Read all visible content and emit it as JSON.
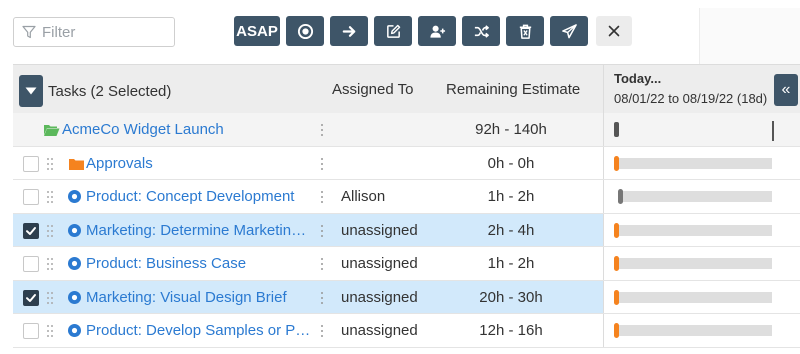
{
  "toolbar": {
    "filter_placeholder": "Filter",
    "asap_label": "ASAP",
    "buttons": [
      {
        "name": "asap-button",
        "icon": "text"
      },
      {
        "name": "target-button",
        "icon": "target-icon"
      },
      {
        "name": "move-right-button",
        "icon": "arrow-right-icon"
      },
      {
        "name": "edit-button",
        "icon": "edit-icon"
      },
      {
        "name": "assign-user-button",
        "icon": "add-user-icon"
      },
      {
        "name": "shuffle-button",
        "icon": "shuffle-icon"
      },
      {
        "name": "delete-button",
        "icon": "trash-icon"
      },
      {
        "name": "send-button",
        "icon": "send-icon"
      },
      {
        "name": "close-button",
        "icon": "close-icon"
      }
    ]
  },
  "header": {
    "title": "Tasks (2 Selected)",
    "assigned_col": "Assigned To",
    "remaining_col": "Remaining Estimate",
    "timeline_today": "Today...",
    "timeline_range": "08/01/22 to 08/19/22 (18d)"
  },
  "rows": [
    {
      "type": "group",
      "name": "AcmeCo Widget Launch",
      "assigned": "",
      "estimate": "92h - 140h",
      "selected": false,
      "icon": "folder-open-icon",
      "icon_color": "#5cb85c"
    },
    {
      "type": "folder",
      "name": "Approvals",
      "assigned": "",
      "estimate": "0h - 0h",
      "selected": false,
      "icon": "folder-icon",
      "icon_color": "#f5831f",
      "bar": "orange"
    },
    {
      "type": "task",
      "name": "Product: Concept Development",
      "assigned": "Allison",
      "estimate": "1h - 2h",
      "selected": false,
      "icon": "task-circle-icon",
      "bar": "grey"
    },
    {
      "type": "task",
      "name": "Marketing: Determine Marketing ...",
      "assigned": "unassigned",
      "estimate": "2h - 4h",
      "selected": true,
      "icon": "task-circle-icon",
      "bar": "orange"
    },
    {
      "type": "task",
      "name": "Product: Business Case",
      "assigned": "unassigned",
      "estimate": "1h - 2h",
      "selected": false,
      "icon": "task-circle-icon",
      "bar": "orange"
    },
    {
      "type": "task",
      "name": "Marketing: Visual Design Brief",
      "assigned": "unassigned",
      "estimate": "20h - 30h",
      "selected": true,
      "icon": "task-circle-icon",
      "bar": "orange"
    },
    {
      "type": "task",
      "name": "Product: Develop Samples or Prot...",
      "assigned": "unassigned",
      "estimate": "12h - 16h",
      "selected": false,
      "icon": "task-circle-icon",
      "bar": "orange"
    }
  ],
  "colors": {
    "accent": "#3e5568",
    "link": "#2b7ad1",
    "selected_row": "#d2e9fb",
    "bar_marker": "#f5831f"
  }
}
